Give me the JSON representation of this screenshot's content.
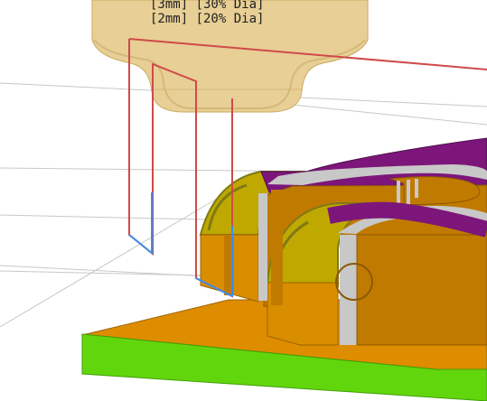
{
  "app": {
    "type": "cam-3d-viewport"
  },
  "overlay": {
    "tool_label_1": "[3mm] [30% Dia]",
    "tool_label_2": "[2mm] [20% Dia]"
  },
  "icons": {
    "tool": "cutting-tool-holder",
    "stock": "stock-block",
    "toolpath": "toolpath-lines"
  },
  "colors": {
    "background": "#ffffff",
    "grid": "#c8c8c8",
    "tool_body": "#e7cf95",
    "tool_shadow": "#d9bd79",
    "part_orange": "#c17a00",
    "part_orange_light": "#d98e00",
    "part_top_orange": "#de8c00",
    "part_yellow": "#bfa800",
    "part_olive": "#7f7a14",
    "part_purple": "#7d167a",
    "part_gray": "#c8c8c8",
    "base_green": "#62d60d",
    "base_green_dark": "#3f9f06",
    "toolpath_red": "#cf4a4a",
    "toolpath_blue": "#3d8df2"
  }
}
